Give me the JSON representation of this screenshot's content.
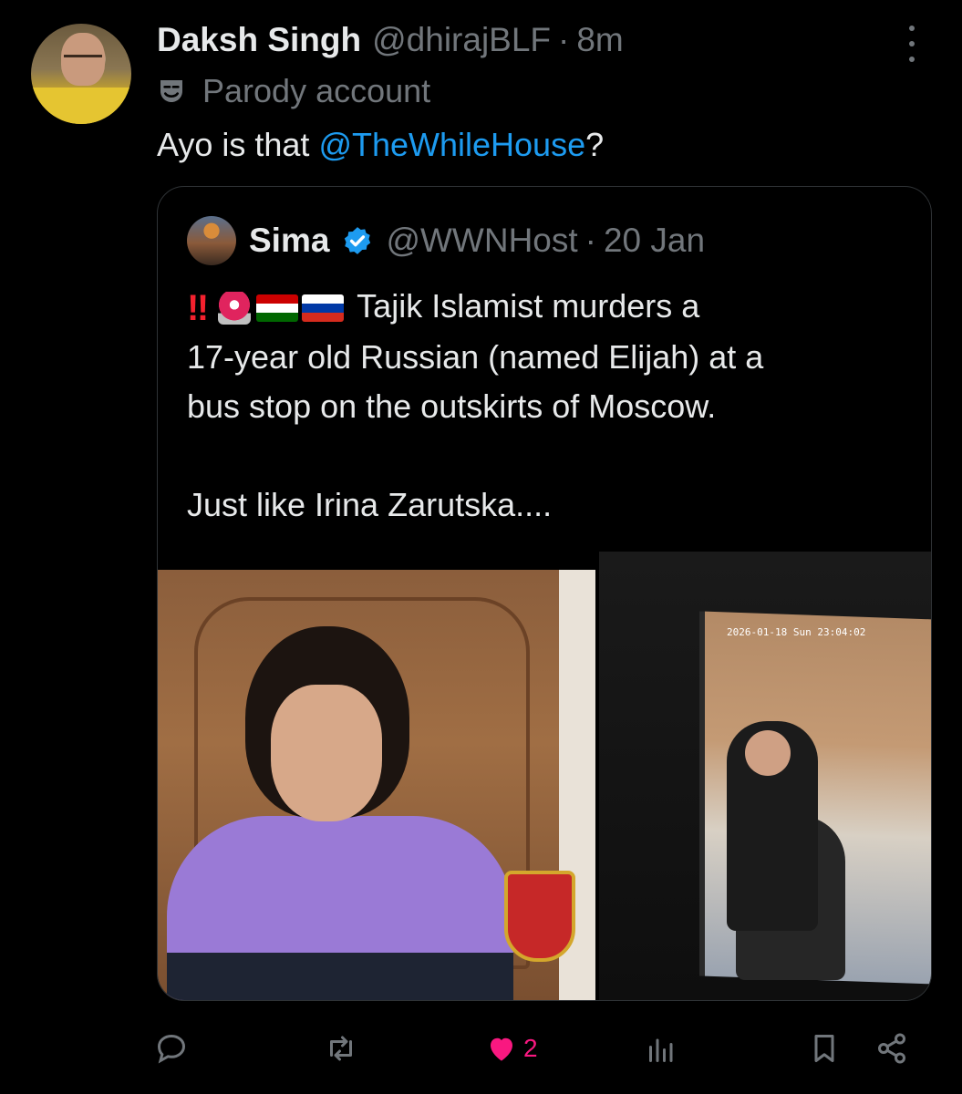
{
  "tweet": {
    "author_name": "Daksh Singh",
    "author_handle": "@dhirajBLF",
    "separator": "·",
    "time": "8m",
    "label": "Parody account",
    "text_prefix": "Ayo is that ",
    "mention": "@TheWhileHouse",
    "text_suffix": "?"
  },
  "quoted": {
    "author_name": "Sima",
    "author_handle": "@WWNHost",
    "separator": "·",
    "time": "20 Jan",
    "line1": "Tajik Islamist murders a",
    "line2": "17-year old Russian (named Elijah) at a",
    "line3": "bus stop on the outskirts of Moscow.",
    "line4": "Just like Irina Zarutska....",
    "bang": "‼",
    "media_timestamp": "2026-01-18  Sun 23:04:02"
  },
  "actions": {
    "like_count": "2"
  },
  "colors": {
    "background": "#000000",
    "text": "#e7e9ea",
    "muted": "#71767b",
    "link": "#1d9bf0",
    "like": "#f91880",
    "verified": "#1d9bf0"
  },
  "icons": {
    "more": "more-dots-icon",
    "parody": "theater-mask-icon",
    "verified": "verified-badge-icon",
    "reply": "reply-icon",
    "repost": "repost-icon",
    "like": "heart-icon",
    "views": "views-icon",
    "bookmark": "bookmark-icon",
    "share": "share-icon"
  }
}
